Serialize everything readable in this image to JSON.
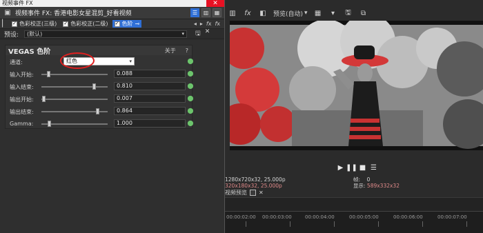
{
  "window": {
    "title": "视频事件 FX",
    "close_glyph": "✕"
  },
  "event": {
    "title": "视频事件 FX: 香港电影女星混剪_好看视频"
  },
  "fx_chain": [
    {
      "label": "色彩校正(三级)",
      "checked": true,
      "active": false
    },
    {
      "label": "色彩校正(二级)",
      "checked": true,
      "active": false
    },
    {
      "label": "色阶",
      "checked": true,
      "active": true
    }
  ],
  "preset": {
    "label": "预设:",
    "value": "(默认)"
  },
  "plugin": {
    "name": "VEGAS 色阶",
    "about": "关于",
    "help": "?"
  },
  "channel": {
    "label": "通道:",
    "value": "红色"
  },
  "params": [
    {
      "label": "输入开始:",
      "value": "0.088",
      "level": 0.088
    },
    {
      "label": "输入结束:",
      "value": "0.810",
      "level": 0.81
    },
    {
      "label": "输出开始:",
      "value": "0.007",
      "level": 0.007
    },
    {
      "label": "输出结束:",
      "value": "0.864",
      "level": 0.864
    },
    {
      "label": "Gamma:",
      "value": "1.000",
      "level": 0.1
    }
  ],
  "preview_toolbar": {
    "quality": "预览(自动)"
  },
  "info": {
    "project": "1280x720x32, 25.000p",
    "preview": "320x180x32, 25.000p",
    "frame_label": "帧:",
    "frame_value": "0",
    "display_label": "显示:",
    "display_value": "589x332x32"
  },
  "subtab": {
    "label": "视频预览",
    "close": "✕"
  },
  "timeline": {
    "ticks": [
      "00:00:02:00",
      "00:00:03:00",
      "00:00:04:00",
      "00:00:05:00",
      "00:00:06:00",
      "00:00:07:00"
    ]
  },
  "colors": {
    "accent": "#2f6fd6",
    "annotation": "#e02020"
  }
}
